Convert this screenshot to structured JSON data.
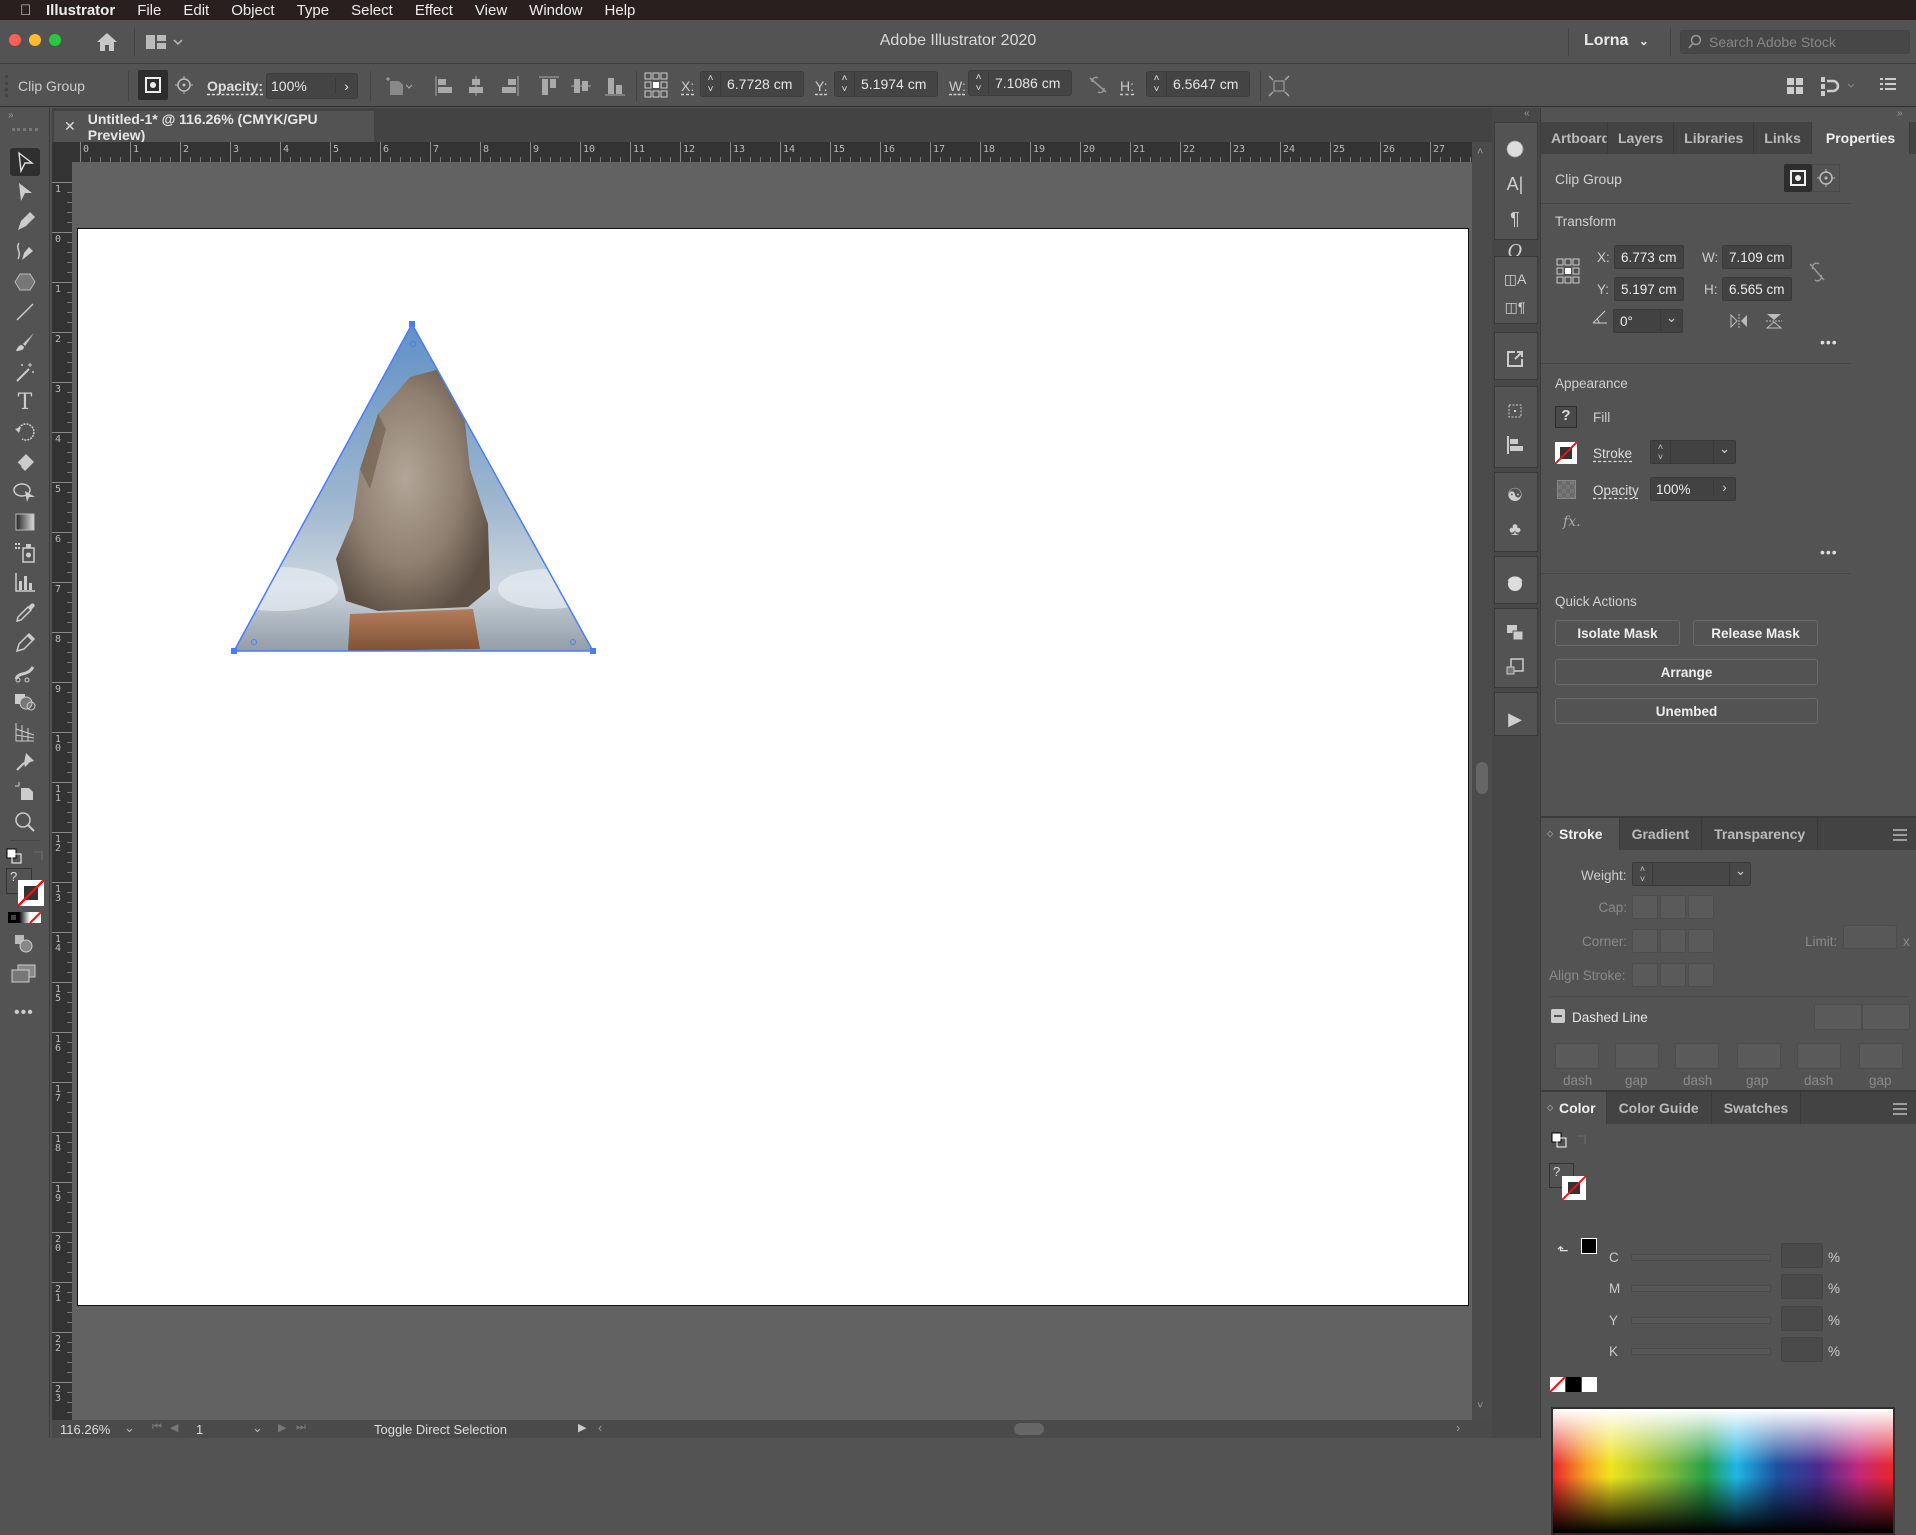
{
  "menubar": {
    "app": "Illustrator",
    "items": [
      "File",
      "Edit",
      "Object",
      "Type",
      "Select",
      "Effect",
      "View",
      "Window",
      "Help"
    ]
  },
  "appbar": {
    "title": "Adobe Illustrator 2020",
    "user": "Lorna",
    "search_placeholder": "Search Adobe Stock"
  },
  "control": {
    "selection_label": "Clip Group",
    "opacity_label": "Opacity:",
    "opacity_value": "100%",
    "x_label": "X:",
    "x_value": "6.7728 cm",
    "y_label": "Y:",
    "y_value": "5.1974 cm",
    "w_label": "W:",
    "w_value": "7.1086 cm",
    "h_label": "H:",
    "h_value": "6.5647 cm"
  },
  "document": {
    "tab_title": "Untitled-1* @ 116.26% (CMYK/GPU Preview)",
    "hruler": [
      "0",
      "1",
      "2",
      "3",
      "4",
      "5",
      "6",
      "7",
      "8",
      "9",
      "10",
      "11",
      "12",
      "13",
      "14",
      "15",
      "16",
      "17",
      "18",
      "19",
      "20",
      "21",
      "22",
      "23",
      "24",
      "25",
      "26",
      "27"
    ],
    "vruler": [
      "1",
      "0",
      "1",
      "2",
      "3",
      "4",
      "5",
      "6",
      "7",
      "8",
      "9",
      "10",
      "11",
      "12",
      "13",
      "14",
      "15",
      "16",
      "17",
      "18",
      "19",
      "20",
      "21",
      "22",
      "23"
    ],
    "selection_color": "#4a7cf7"
  },
  "status": {
    "zoom": "116.26%",
    "artboard": "1",
    "tool_info": "Toggle Direct Selection"
  },
  "properties": {
    "tabs": [
      "Artboard",
      "Layers",
      "Libraries",
      "Links",
      "Properties"
    ],
    "active_tab": "Properties",
    "header": "Clip Group",
    "transform": {
      "title": "Transform",
      "x_label": "X:",
      "x": "6.773 cm",
      "y_label": "Y:",
      "y": "5.197 cm",
      "w_label": "W:",
      "w": "7.109 cm",
      "h_label": "H:",
      "h": "6.565 cm",
      "angle": "0°"
    },
    "appearance": {
      "title": "Appearance",
      "fill_label": "Fill",
      "fill_icon": "?",
      "stroke_label": "Stroke",
      "opacity_label": "Opacity",
      "opacity_value": "100%",
      "fx_label": "fx."
    },
    "quick_actions": {
      "title": "Quick Actions",
      "buttons": [
        "Isolate Mask",
        "Release Mask",
        "Arrange",
        "Unembed"
      ]
    }
  },
  "stroke_panel": {
    "tabs": [
      "Stroke",
      "Gradient",
      "Transparency"
    ],
    "weight_label": "Weight:",
    "cap_label": "Cap:",
    "corner_label": "Corner:",
    "limit_label": "Limit:",
    "limit_suffix": "x",
    "align_label": "Align Stroke:",
    "dashed_label": "Dashed Line",
    "dash_labels": [
      "dash",
      "gap",
      "dash",
      "gap",
      "dash",
      "gap"
    ]
  },
  "color_panel": {
    "tabs": [
      "Color",
      "Color Guide",
      "Swatches"
    ],
    "channels": [
      "C",
      "M",
      "Y",
      "K"
    ],
    "unit": "%"
  }
}
